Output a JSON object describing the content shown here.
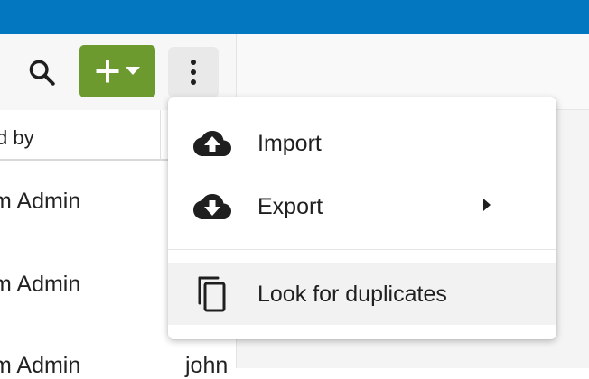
{
  "toolbar": {
    "search_icon": "search-icon",
    "add_icon": "plus-icon",
    "add_caret_icon": "caret-down-icon",
    "more_icon": "vertical-dots-icon"
  },
  "table": {
    "header_partial": "d by",
    "rows": [
      {
        "created_by": "m Admin",
        "extra": ""
      },
      {
        "created_by": "m Admin",
        "extra": ""
      },
      {
        "created_by": "m Admin",
        "extra": "john"
      }
    ]
  },
  "menu": {
    "items": [
      {
        "label": "Import",
        "icon": "cloud-upload-icon"
      },
      {
        "label": "Export",
        "icon": "cloud-download-icon",
        "submenu_icon": "caret-right-icon"
      },
      {
        "label": "Look for duplicates",
        "icon": "copy-icon"
      }
    ]
  },
  "colors": {
    "topbar": "#0377c0",
    "add_button": "#6c9a2f",
    "menu_hover": "#f2f2f2"
  }
}
